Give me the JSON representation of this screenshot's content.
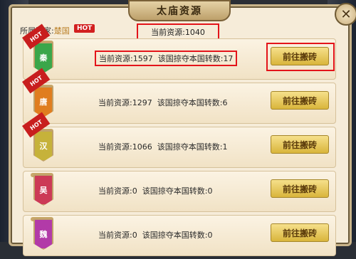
{
  "title": "太庙资源",
  "close_glyph": "✕",
  "header": {
    "country_label": "所属国家:",
    "country": "楚国",
    "hot": "HOT",
    "total_resource": "当前资源:1040"
  },
  "rows": [
    {
      "name": "秦",
      "hot": true,
      "hot_text": "HOT",
      "color": "#3aa64a",
      "resource_label": "当前资源:",
      "resource": "1597",
      "plunder_label": "该国掠夺本国转数:",
      "plunder": "17",
      "button": "前往搬砖",
      "highlighted": true
    },
    {
      "name": "唐",
      "hot": true,
      "hot_text": "HOT",
      "color": "#e07d1f",
      "resource_label": "当前资源:",
      "resource": "1297",
      "plunder_label": "该国掠夺本国转数:",
      "plunder": "6",
      "button": "前往搬砖",
      "highlighted": false
    },
    {
      "name": "汉",
      "hot": true,
      "hot_text": "HOT",
      "color": "#c6b23a",
      "resource_label": "当前资源:",
      "resource": "1066",
      "plunder_label": "该国掠夺本国转数:",
      "plunder": "1",
      "button": "前往搬砖",
      "highlighted": false
    },
    {
      "name": "吴",
      "hot": false,
      "hot_text": "",
      "color": "#cc3a56",
      "resource_label": "当前资源:",
      "resource": "0",
      "plunder_label": "该国掠夺本国转数:",
      "plunder": "0",
      "button": "前往搬砖",
      "highlighted": false
    },
    {
      "name": "魏",
      "hot": false,
      "hot_text": "",
      "color": "#b23aa8",
      "resource_label": "当前资源:",
      "resource": "0",
      "plunder_label": "该国掠夺本国转数:",
      "plunder": "0",
      "button": "前往搬砖",
      "highlighted": false
    }
  ]
}
